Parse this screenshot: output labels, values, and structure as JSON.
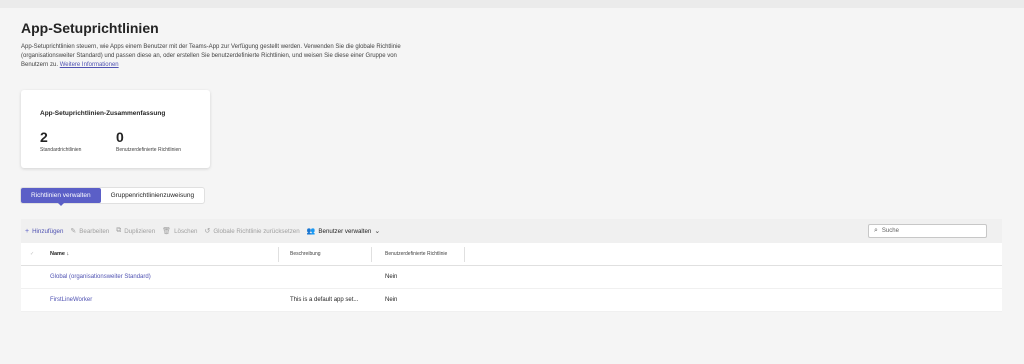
{
  "page": {
    "title": "App-Setuprichtlinien",
    "description": "App-Setuprichtlinien steuern, wie Apps einem Benutzer mit der Teams-App zur Verfügung gestellt werden. Verwenden Sie die globale Richtlinie (organisationsweiter Standard) und passen diese an, oder erstellen Sie benutzerdefinierte Richtlinien, und weisen Sie diese einer Gruppe von Benutzern zu.",
    "learn_more": "Weitere Informationen"
  },
  "summary": {
    "title": "App-Setuprichtlinien-Zusammenfassung",
    "standard_count": "2",
    "standard_label": "Standardrichtlinien",
    "custom_count": "0",
    "custom_label": "Benutzerdefinierte Richtlinien"
  },
  "tabs": [
    {
      "label": "Richtlinien verwalten",
      "active": true
    },
    {
      "label": "Gruppenrichtlinienzuweisung",
      "active": false
    }
  ],
  "toolbar": {
    "add": "Hinzufügen",
    "edit": "Bearbeiten",
    "duplicate": "Duplizieren",
    "delete": "Löschen",
    "reset_global": "Globale Richtlinie zurücksetzen",
    "manage_users": "Benutzer verwalten",
    "search_placeholder": "Suche"
  },
  "table": {
    "headers": {
      "name": "Name",
      "description": "Beschreibung",
      "custom": "Benutzerdefinierte Richtlinie"
    },
    "rows": [
      {
        "name": "Global (organisationsweiter Standard)",
        "description": "",
        "custom": "Nein"
      },
      {
        "name": "FirstLineWorker",
        "description": "This is a default app set...",
        "custom": "Nein"
      }
    ]
  },
  "colors": {
    "accent": "#5b5fc7",
    "link": "#4f52b2"
  }
}
